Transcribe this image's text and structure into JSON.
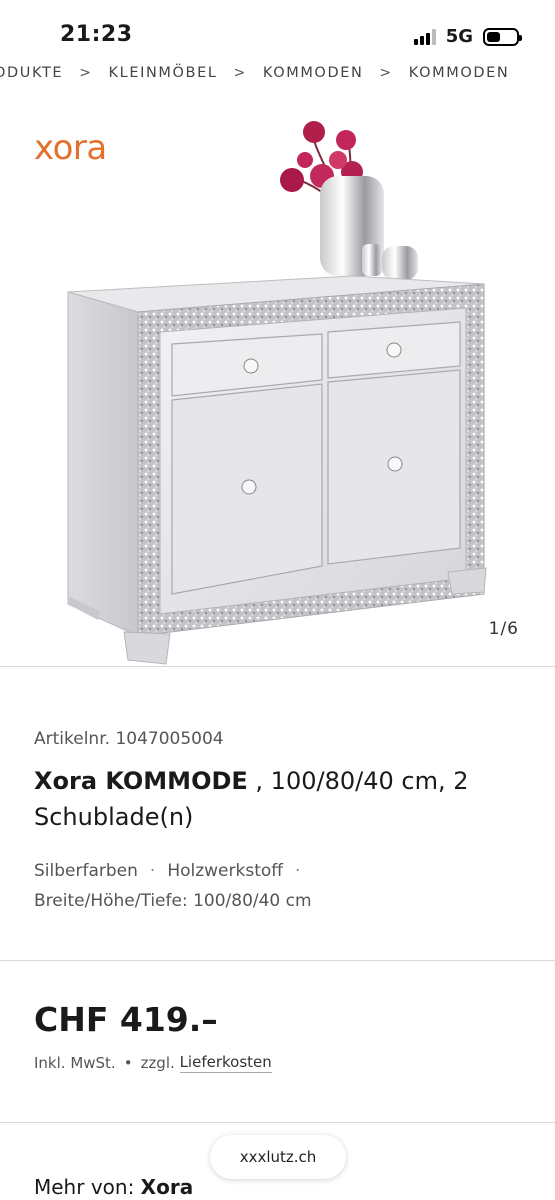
{
  "status_bar": {
    "time": "21:23",
    "network": "5G"
  },
  "breadcrumb": {
    "items": [
      "ODUKTE",
      "KLEINMÖBEL",
      "KOMMODEN",
      "KOMMODEN"
    ],
    "separator": ">"
  },
  "gallery": {
    "brand_logo": "xora",
    "counter": "1/6",
    "accent_color": "#e2712f"
  },
  "product": {
    "article_no": "Artikelnr. 1047005004",
    "title_bold": "Xora KOMMODE",
    "title_rest": " , 100/80/40 cm, 2 Schublade(n)",
    "attr_color": "Silberfarben",
    "attr_material": "Holzwerkstoff",
    "attr_dims": "Breite/Höhe/Tiefe: 100/80/40 cm"
  },
  "pricing": {
    "price": "CHF 419.–",
    "vat_note": "Inkl. MwSt.",
    "shipping_prefix": "zzgl.",
    "shipping_link": "Lieferkosten"
  },
  "more_from": {
    "label": "Mehr von:",
    "brand": "Xora"
  },
  "browser": {
    "url": "xxxlutz.ch"
  }
}
